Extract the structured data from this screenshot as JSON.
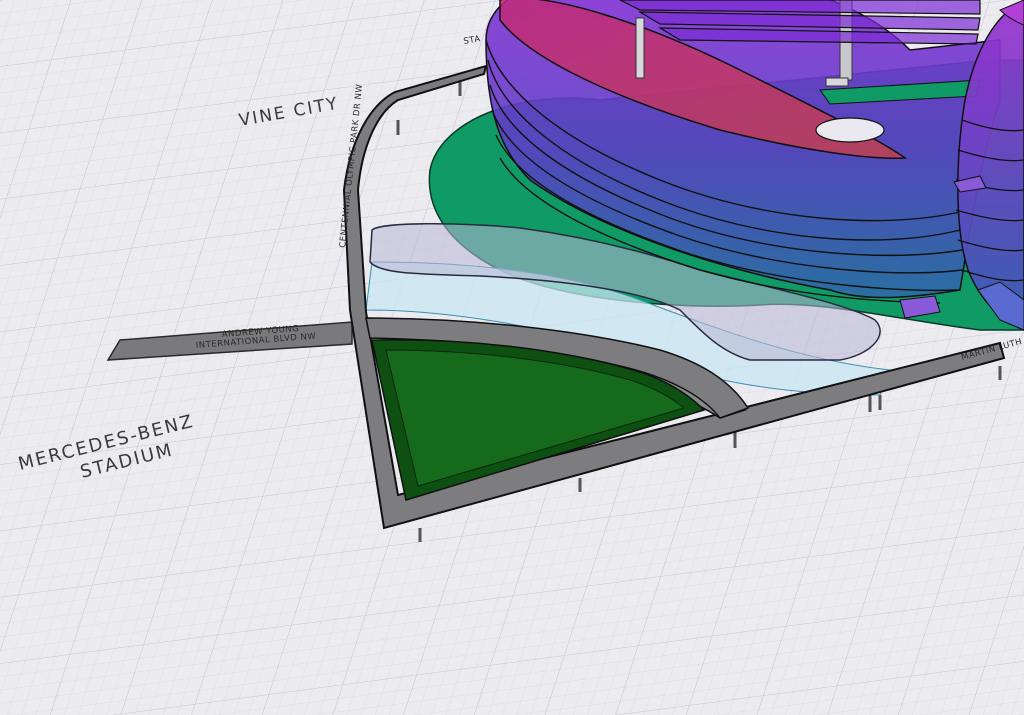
{
  "labels": {
    "vine_city": "VINE CITY",
    "mercedes_benz_line1": "MERCEDES-BENZ",
    "mercedes_benz_line2": "STADIUM",
    "andrew_young_line1": "ANDREW YOUNG",
    "andrew_young_line2": "INTERNATIONAL BLVD NW",
    "centennial_olympic_park": "CENTENNIAL OLYMPIC PARK DR NW",
    "martin_luther_king": "MARTIN LUTH",
    "stadium_fragment": "STA"
  },
  "colors": {
    "ground": "#ecebf0",
    "grid_minor": "#d9d8e0",
    "grid_major": "#c6c5cf",
    "path_fill": "#7d7d80",
    "park_green": "#0f9a66",
    "lawn_dark": "#0e4f12",
    "lawn_mid": "#156b1b",
    "building_purple": "#7b2fd6",
    "building_blue": "#2c5ea8",
    "canopy_magenta": "#b0246d",
    "water_light": "#c8e6f2"
  }
}
